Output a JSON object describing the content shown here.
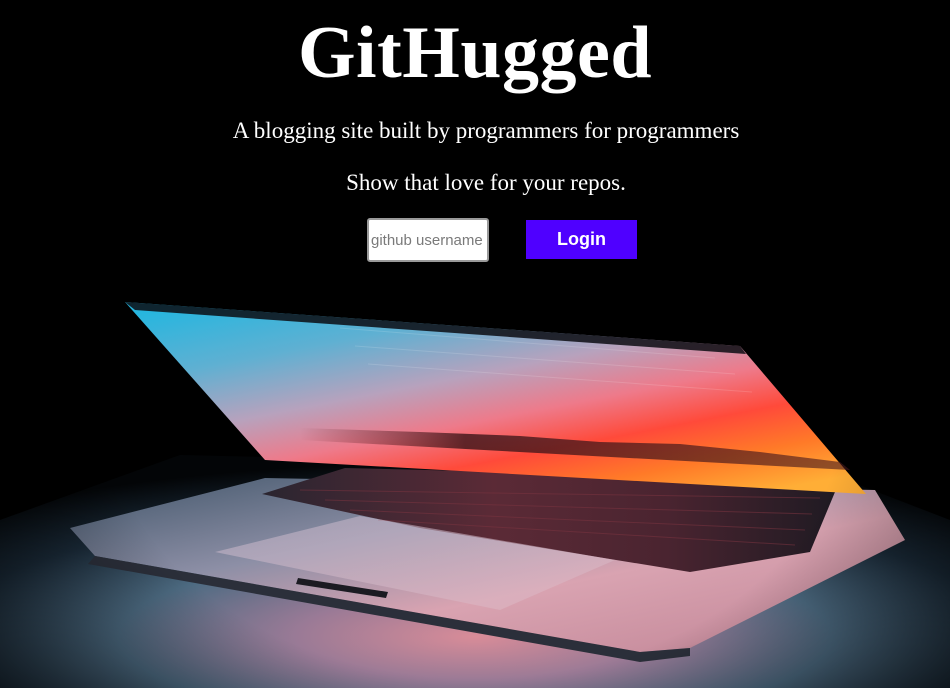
{
  "hero": {
    "title": "GitHugged",
    "tagline": "A blogging site built by programmers for programmers",
    "sub_tagline": "Show that love for your repos."
  },
  "login_form": {
    "username_placeholder": "github username",
    "username_value": "",
    "login_label": "Login"
  },
  "colors": {
    "background": "#000000",
    "login_button": "#4f00ff",
    "text": "#ffffff"
  },
  "illustration": {
    "subject": "laptop-photo"
  }
}
